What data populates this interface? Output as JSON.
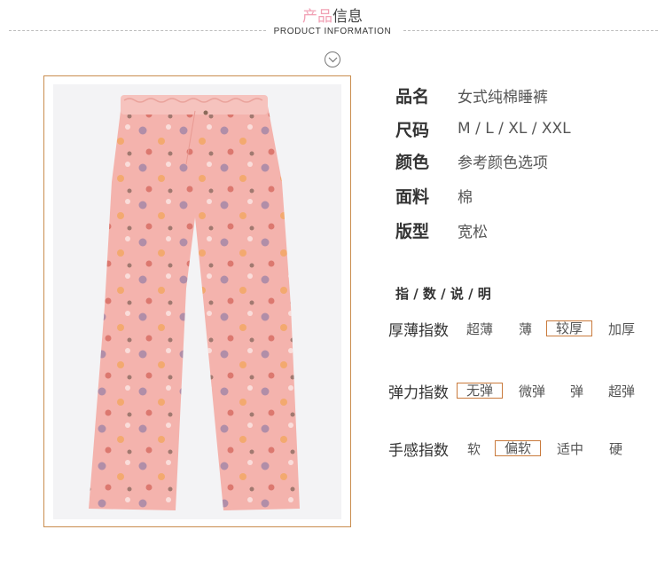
{
  "header": {
    "title_pink": "产品",
    "title_dark": "信息",
    "subtitle": "PRODUCT INFORMATION"
  },
  "specs": [
    {
      "label": "品名",
      "value": "女式纯棉睡裤"
    },
    {
      "label": "尺码",
      "value": "M / L / XL / XXL"
    },
    {
      "label": "颜色",
      "value": "参考颜色选项"
    },
    {
      "label": "面料",
      "value": "棉"
    },
    {
      "label": "版型",
      "value": "宽松"
    }
  ],
  "guide_title": "指 / 数 / 说 / 明",
  "indices": [
    {
      "label": "厚薄指数",
      "options": [
        "超薄",
        "薄",
        "较厚",
        "加厚"
      ],
      "selected": "较厚"
    },
    {
      "label": "弹力指数",
      "options": [
        "无弹",
        "微弹",
        "弹",
        "超弹"
      ],
      "selected": "无弹"
    },
    {
      "label": "手感指数",
      "options": [
        "软",
        "偏软",
        "适中",
        "硬"
      ],
      "selected": "偏软"
    }
  ],
  "colors": {
    "accent_pink": "#f1a0b4",
    "frame_border": "#c98d4f",
    "select_border": "#c97a3c",
    "pants_pink": "#f4b3ad"
  }
}
